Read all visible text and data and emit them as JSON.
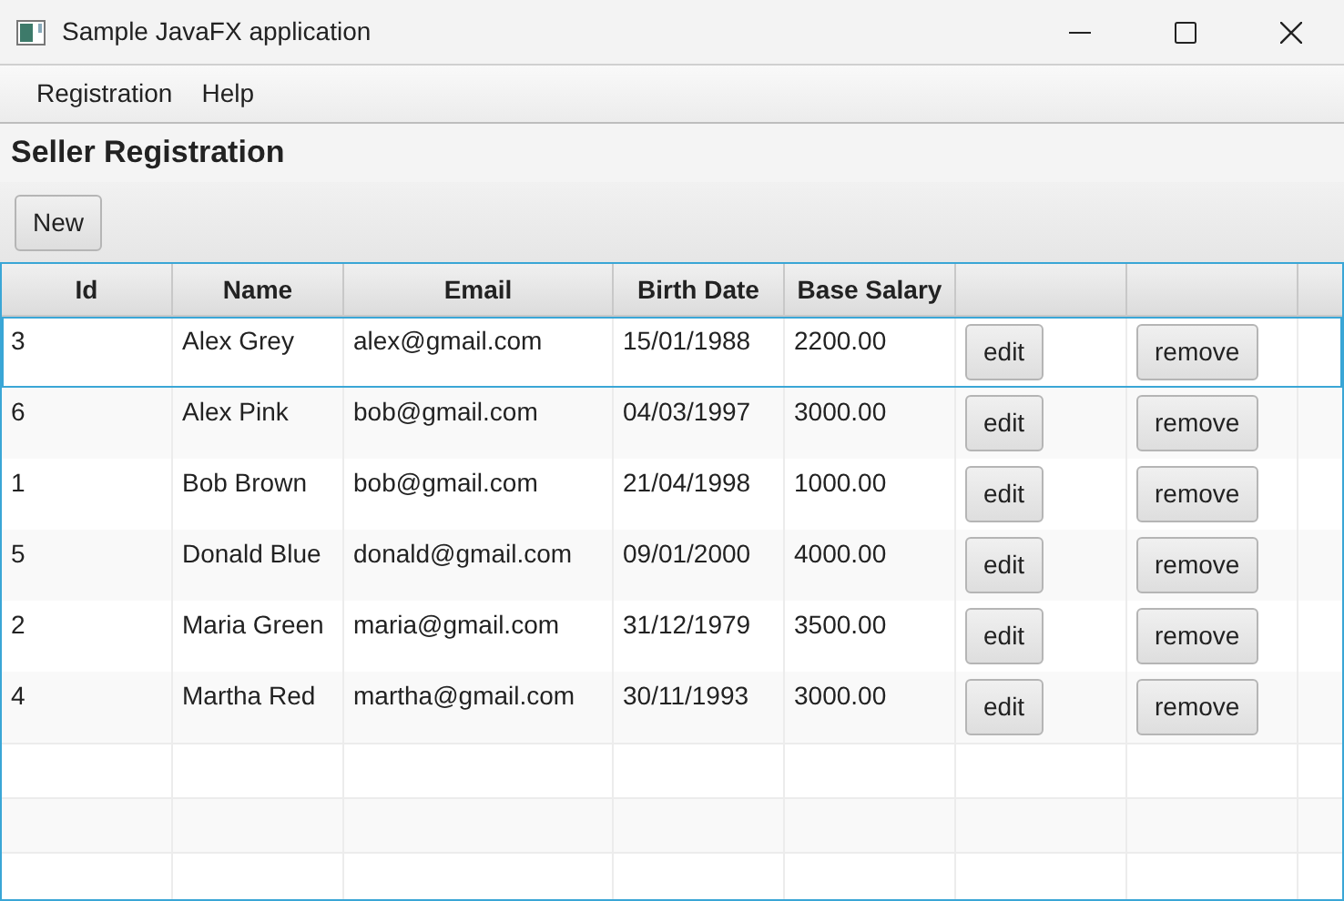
{
  "window": {
    "title": "Sample JavaFX application"
  },
  "menu": [
    "Registration",
    "Help"
  ],
  "heading": "Seller Registration",
  "toolbar": {
    "new_button": "New"
  },
  "table": {
    "columns": [
      "Id",
      "Name",
      "Email",
      "Birth Date",
      "Base Salary"
    ],
    "rows": [
      {
        "id": "3",
        "name": "Alex Grey",
        "email": "alex@gmail.com",
        "birth_date": "15/01/1988",
        "base_salary": "2200.00",
        "edit": "edit",
        "remove": "remove",
        "selected": true
      },
      {
        "id": "6",
        "name": "Alex Pink",
        "email": "bob@gmail.com",
        "birth_date": "04/03/1997",
        "base_salary": "3000.00",
        "edit": "edit",
        "remove": "remove",
        "selected": false
      },
      {
        "id": "1",
        "name": "Bob Brown",
        "email": "bob@gmail.com",
        "birth_date": "21/04/1998",
        "base_salary": "1000.00",
        "edit": "edit",
        "remove": "remove",
        "selected": false
      },
      {
        "id": "5",
        "name": "Donald Blue",
        "email": "donald@gmail.com",
        "birth_date": "09/01/2000",
        "base_salary": "4000.00",
        "edit": "edit",
        "remove": "remove",
        "selected": false
      },
      {
        "id": "2",
        "name": "Maria Green",
        "email": "maria@gmail.com",
        "birth_date": "31/12/1979",
        "base_salary": "3500.00",
        "edit": "edit",
        "remove": "remove",
        "selected": false
      },
      {
        "id": "4",
        "name": "Martha Red",
        "email": "martha@gmail.com",
        "birth_date": "30/11/1993",
        "base_salary": "3000.00",
        "edit": "edit",
        "remove": "remove",
        "selected": false
      }
    ]
  }
}
